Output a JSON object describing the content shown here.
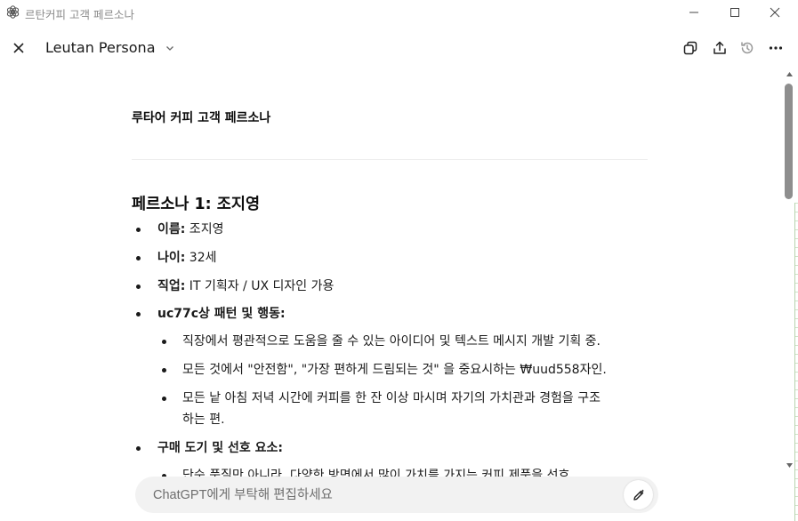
{
  "window": {
    "title": "르탄커피 고객 페르소나"
  },
  "header": {
    "title": "Leutan Persona"
  },
  "document": {
    "heading": "루타어 커피 고객 페르소나",
    "persona_heading": "페르소나 1: 조지영",
    "items": [
      {
        "label": "이름:",
        "value": " 조지영"
      },
      {
        "label": "나이:",
        "value": " 32세"
      },
      {
        "label": "직업:",
        "value": " IT 기획자 / UX 디자인 가용"
      },
      {
        "label": "uc77c상 패턴 및 행동:",
        "value": ""
      }
    ],
    "sub_items": [
      "직장에서 평관적으로 도움을 줄 수 있는 아이디어 및 텍스트 메시지 개발 기획 중.",
      "모든 것에서 \"안전함\", \"가장 편하게 드림되는 것\" 을 중요시하는 ₩uud558자인.",
      "모든 낱 아침 저녁 시간에 커피를 한 잔 이상 마시며 자기의 가치관과 경험을 구조",
      "하는 편."
    ],
    "item_purchase": {
      "label": "구매 도기 및 선호 요소:",
      "value": ""
    },
    "cut_sub_item": "단순 품질만 아니라, 다양한 방면에서 많이 가치를 가지는 커피 제품을 선호."
  },
  "composer": {
    "placeholder": "ChatGPT에게 부탁해 편집하세요"
  },
  "icons": {
    "app": "openai-logo-icon",
    "minimize": "minimize-icon",
    "maximize": "maximize-icon",
    "close": "close-icon",
    "copy": "copy-icon",
    "share": "share-icon",
    "history": "history-icon",
    "more": "more-icon",
    "edit": "edit-icon"
  }
}
